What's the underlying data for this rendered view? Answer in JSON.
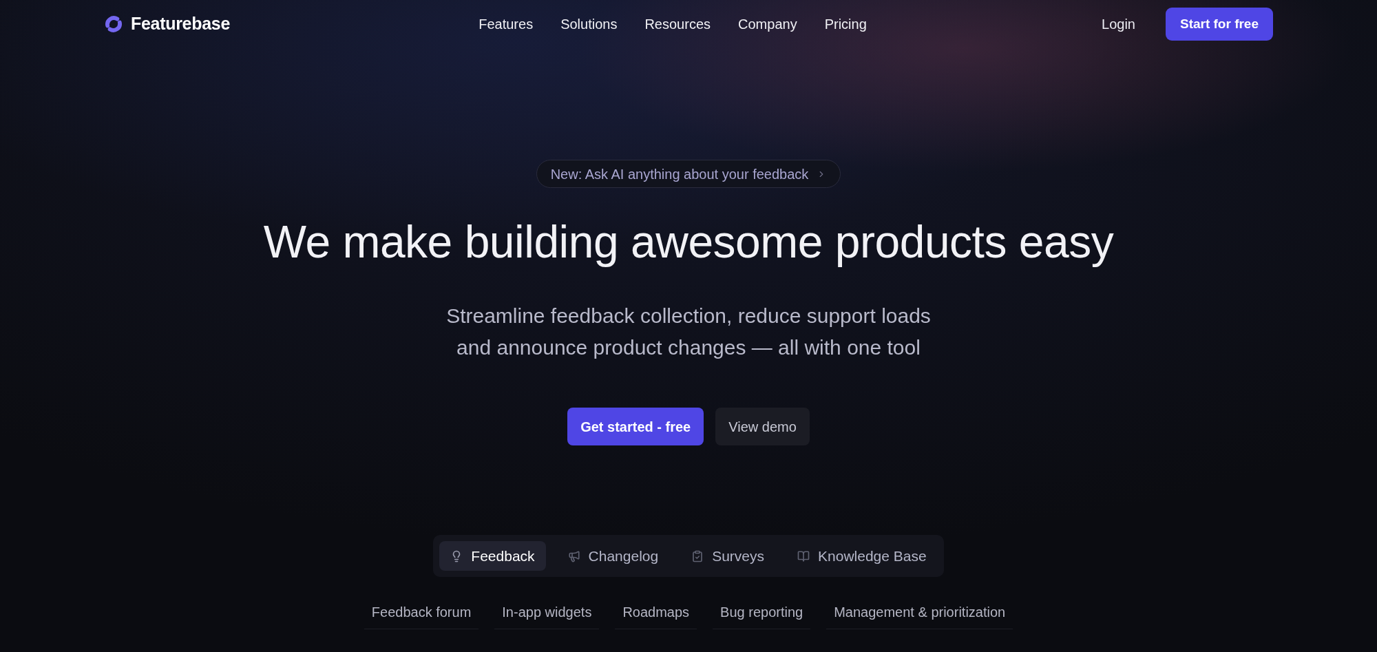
{
  "nav": {
    "brand": "Featurebase",
    "links": [
      "Features",
      "Solutions",
      "Resources",
      "Company",
      "Pricing"
    ],
    "login": "Login",
    "cta": "Start for free"
  },
  "hero": {
    "badge": "New: Ask AI anything about your feedback",
    "headline": "We make building awesome products easy",
    "subtitle": "Streamline feedback collection, reduce support loads and announce product changes — all with one tool",
    "buttons": [
      {
        "label": "Get started - free",
        "kind": "primary"
      },
      {
        "label": "View demo",
        "kind": "secondary"
      }
    ]
  },
  "product_tabs": [
    {
      "label": "Feedback",
      "selected": true
    },
    {
      "label": "Changelog",
      "selected": false
    },
    {
      "label": "Surveys",
      "selected": false
    },
    {
      "label": "Knowledge Base",
      "selected": false
    }
  ],
  "feature_links": [
    "Feedback forum",
    "In-app widgets",
    "Roadmaps",
    "Bug reporting",
    "Management & prioritization"
  ]
}
